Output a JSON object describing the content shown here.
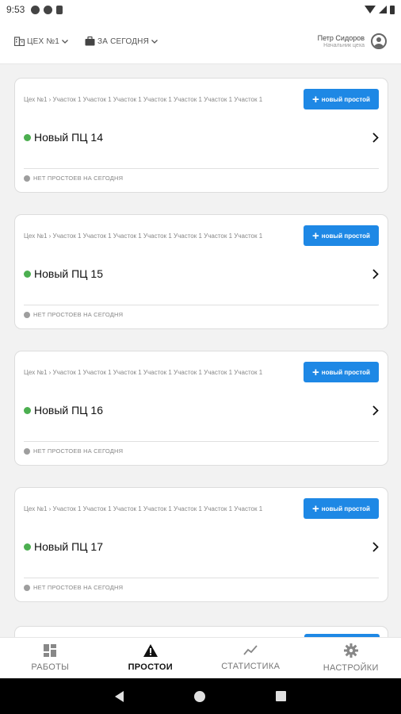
{
  "status_bar": {
    "time": "9:53"
  },
  "header": {
    "workshop_filter": "ЦЕХ №1",
    "period_filter": "ЗА СЕГОДНЯ",
    "user_name": "Петр Сидоров",
    "user_role": "Начальник цеха"
  },
  "cards": [
    {
      "breadcrumb": "Цех №1 › Участок 1 Участок 1 Участок 1 Участок 1 Участок 1 Участок 1 Участок 1",
      "new_downtime_label": "новый простой",
      "title": "Новый ПЦ 14",
      "status": "НЕТ ПРОСТОЕВ НА СЕГОДНЯ"
    },
    {
      "breadcrumb": "Цех №1 › Участок 1 Участок 1 Участок 1 Участок 1 Участок 1 Участок 1 Участок 1",
      "new_downtime_label": "новый простой",
      "title": "Новый ПЦ 15",
      "status": "НЕТ ПРОСТОЕВ НА СЕГОДНЯ"
    },
    {
      "breadcrumb": "Цех №1 › Участок 1 Участок 1 Участок 1 Участок 1 Участок 1 Участок 1 Участок 1",
      "new_downtime_label": "новый простой",
      "title": "Новый ПЦ 16",
      "status": "НЕТ ПРОСТОЕВ НА СЕГОДНЯ"
    },
    {
      "breadcrumb": "Цех №1 › Участок 1 Участок 1 Участок 1 Участок 1 Участок 1 Участок 1 Участок 1",
      "new_downtime_label": "новый простой",
      "title": "Новый ПЦ 17",
      "status": "НЕТ ПРОСТОЕВ НА СЕГОДНЯ"
    }
  ],
  "bottom_nav": {
    "items": [
      {
        "label": "РАБОТЫ",
        "icon": "dashboard-icon",
        "active": false
      },
      {
        "label": "ПРОСТОИ",
        "icon": "warning-icon",
        "active": true
      },
      {
        "label": "СТАТИСТИКА",
        "icon": "trending-icon",
        "active": false
      },
      {
        "label": "НАСТРОЙКИ",
        "icon": "gear-icon",
        "active": false
      }
    ]
  },
  "colors": {
    "accent": "#1e88e5",
    "status_ok": "#4caf50",
    "status_none": "#9e9e9e",
    "background": "#f2f2f2"
  }
}
